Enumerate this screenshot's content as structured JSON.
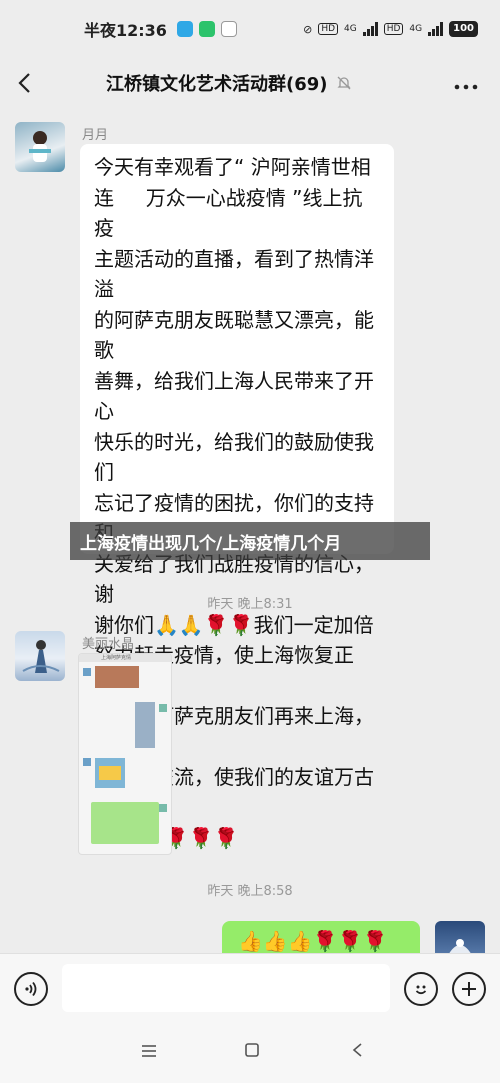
{
  "status_bar": {
    "time": "半夜12:36",
    "network_1": "4G",
    "network_2": "4G",
    "hd_1": "HD",
    "hd_2": "HD",
    "battery": "100"
  },
  "header": {
    "title": "江桥镇文化艺术活动群(69)",
    "back_icon": "chevron-left-icon",
    "mute_icon": "bell-mute-icon",
    "more_icon": "more-dots-icon"
  },
  "messages": [
    {
      "sender": "月月",
      "text": "今天有幸观看了“ 沪阿亲情世相\n连     万众一心战疫情 ”线上抗疫\n主题活动的直播，看到了热情洋溢\n的阿萨克朋友既聪慧又漂亮，能歌\n善舞，给我们上海人民带来了开心\n快乐的时光，给我们的鼓励使我们\n忘记了疫情的困扰，你们的支持和\n关爱给了我们战胜疫情的信心，谢\n谢你们🙏🙏🌹🌹我们一定加倍\n努力赶走疫情，使上海恢复正常，\n也欢迎阿萨克朋友们再来上海，我\n们互相交流，使我们的友谊万古长\n青🙏🙏🌹🌹🌹"
    },
    {
      "time": "昨天 晚上8:31"
    },
    {
      "sender": "美丽水晶",
      "image_caption": "上海阿萨克情"
    },
    {
      "time": "昨天 晚上8:58"
    },
    {
      "self_text": "👍👍👍🌹🌹🌹"
    }
  ],
  "banner": "上海疫情出现几个/上海疫情几个月",
  "input_bar": {
    "voice_icon": "voice-icon",
    "emoji_icon": "emoji-icon",
    "plus_icon": "plus-icon"
  },
  "nav": {
    "menu_icon": "menu-icon",
    "home_icon": "home-square-icon",
    "back_icon": "back-triangle-icon"
  },
  "colors": {
    "background": "#ededed",
    "self_bubble": "#95ec69",
    "other_bubble": "#ffffff"
  }
}
